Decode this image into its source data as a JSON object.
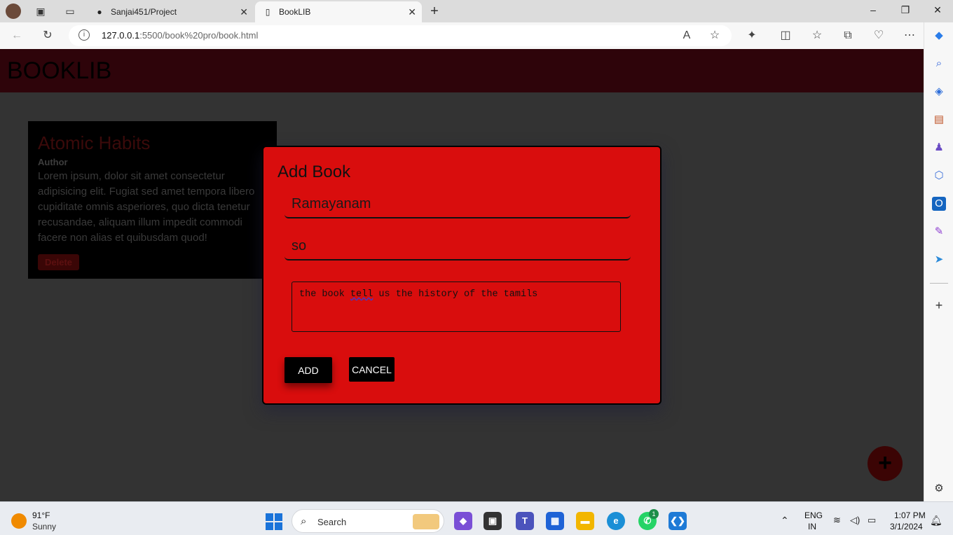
{
  "browser": {
    "tabs": [
      {
        "title": "Sanjai451/Project",
        "favicon": "github-icon"
      },
      {
        "title": "BookLIB",
        "favicon": "page-icon",
        "active": true
      }
    ],
    "url_host": "127.0.0.1",
    "url_path": ":5500/book%20pro/book.html"
  },
  "app": {
    "title": "BOOKLIB",
    "colors": {
      "header": "#2e040a",
      "modal": "#d90d0d",
      "background": "#333333"
    }
  },
  "book_card": {
    "title": "Atomic Habits",
    "author": "Author",
    "description": "Lorem ipsum, dolor sit amet consectetur adipisicing elit. Fugiat sed amet tempora libero cupiditate omnis asperiores, quo dicta tenetur recusandae, aliquam illum impedit commodi facere non alias et quibusdam quod!",
    "delete_label": "Delete"
  },
  "modal": {
    "title": "Add Book",
    "title_value": "Ramayanam",
    "author_value": "so",
    "description_before": "the book ",
    "description_misspelled": "tell",
    "description_after": " us the history of the tamils",
    "add_label": "ADD",
    "cancel_label": "CANCEL"
  },
  "fab": {
    "label": "+"
  },
  "taskbar": {
    "weather_temp": "91°F",
    "weather_condition": "Sunny",
    "search_label": "Search",
    "lang_top": "ENG",
    "lang_bottom": "IN",
    "time": "1:07 PM",
    "date": "3/1/2024",
    "whatsapp_badge": "1"
  }
}
